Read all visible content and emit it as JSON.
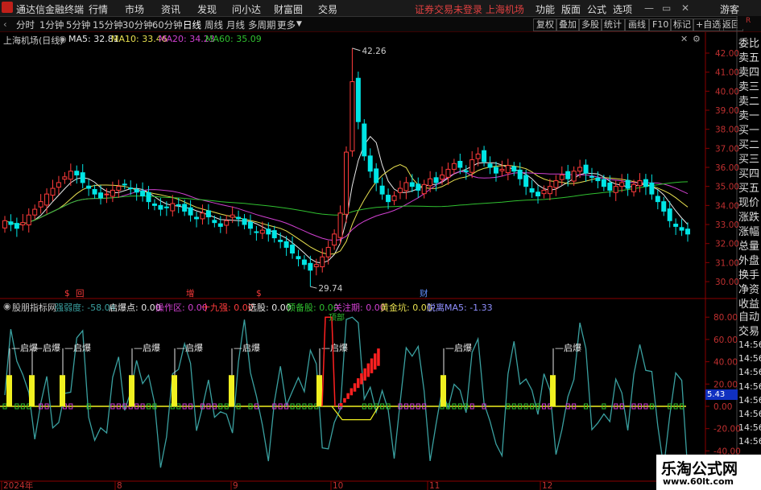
{
  "app": {
    "title": "通达信金融终端",
    "menus": [
      "行情",
      "市场",
      "资讯",
      "发现",
      "问小达",
      "财富圈",
      "交易"
    ],
    "warning": "证券交易未登录 上海机场",
    "right_menus": [
      "功能",
      "版面",
      "公式",
      "选项"
    ],
    "guest": "游客"
  },
  "periods": [
    "分时",
    "1分钟",
    "5分钟",
    "15分钟",
    "30分钟",
    "60分钟",
    "日线",
    "周线",
    "月线",
    "多周期",
    "更多"
  ],
  "selected_period": "日线",
  "toolbar": [
    "复权",
    "叠加",
    "多股",
    "统计",
    "画线",
    "F10",
    "标记",
    "+自选",
    "返回"
  ],
  "main_header": {
    "name": "上海机场(日线)",
    "ma5": "MA5: 32.81",
    "ma10": "MA10: 33.46",
    "ma20": "MA20: 34.23",
    "ma60": "MA60: 35.09"
  },
  "colors": {
    "up": "#ff3b3b",
    "down": "#00e5e5",
    "ma5": "#e8e8e8",
    "ma10": "#e8e050",
    "ma20": "#d040d0",
    "ma60": "#30c030",
    "indicator_line": "#3aa0a0",
    "yellow": "#f0f020"
  },
  "price_axis": [
    "42.00",
    "41.00",
    "40.00",
    "39.00",
    "38.00",
    "37.00",
    "36.00",
    "35.00",
    "34.00",
    "33.00",
    "32.00",
    "31.00",
    "30.00"
  ],
  "high_label": "42.26",
  "low_label": "29.74",
  "event_markers": [
    {
      "x": 80,
      "label": "$"
    },
    {
      "x": 94,
      "label": "回"
    },
    {
      "x": 231,
      "label": "增"
    },
    {
      "x": 318,
      "label": "$"
    },
    {
      "x": 521,
      "label": "财"
    }
  ],
  "sub_header": {
    "name": "股朋指标网",
    "items": [
      "强弱度: -58.04",
      "启爆点: 0.00",
      "操作区: 0.00",
      "十九强: 0.00",
      "选股: 0.00",
      "预备股: 0.00",
      "关注期: 0.00",
      "黄金坑: 0.00",
      "脱离MA5: -1.33"
    ]
  },
  "sub_axis": [
    "80.00",
    "60.00",
    "40.00",
    "20.00",
    "0.00",
    "-20.00",
    "-40.00"
  ],
  "sub_value": "5.43",
  "qibao_label": "启爆",
  "qibao_positions": [
    12,
    40,
    78,
    164,
    217,
    288,
    397,
    551,
    687
  ],
  "top_label": "顶部",
  "date_labels": [
    {
      "x": 2,
      "label": "2024年"
    },
    {
      "x": 143,
      "label": "8"
    },
    {
      "x": 287,
      "label": "9"
    },
    {
      "x": 411,
      "label": "10"
    },
    {
      "x": 531,
      "label": "11"
    },
    {
      "x": 671,
      "label": "12"
    }
  ],
  "side_panel": [
    "委比",
    "卖五",
    "卖四",
    "卖三",
    "卖二",
    "卖一",
    "买一",
    "买二",
    "买三",
    "买四",
    "买五",
    "现价",
    "涨跌",
    "涨幅",
    "总量",
    "外盘",
    "换手",
    "净资",
    "收益"
  ],
  "side_panel2": [
    "自动",
    "交易"
  ],
  "side_times": [
    "14:56",
    "14:56",
    "14:56",
    "14:56",
    "14:56",
    "14:56",
    "14:56",
    "14:56"
  ],
  "watermark": {
    "line1": "乐淘公式网",
    "line2": "www.60lt.com"
  },
  "chart_data": {
    "type": "candlestick",
    "ylim": [
      29.5,
      42.5
    ],
    "closes": [
      33.2,
      33.0,
      32.8,
      33.1,
      33.5,
      33.8,
      34.2,
      34.6,
      34.9,
      35.2,
      35.5,
      35.8,
      35.6,
      35.2,
      34.9,
      34.6,
      34.4,
      34.6,
      34.8,
      35.0,
      35.1,
      34.9,
      34.7,
      34.5,
      34.2,
      34.0,
      33.8,
      33.9,
      34.1,
      34.0,
      33.7,
      33.5,
      33.3,
      33.6,
      33.4,
      33.1,
      32.9,
      33.2,
      33.5,
      33.3,
      33.0,
      32.8,
      32.6,
      32.7,
      32.5,
      32.3,
      32.1,
      31.8,
      31.5,
      31.2,
      30.9,
      30.6,
      30.9,
      31.3,
      31.8,
      32.5,
      33.6,
      36.8,
      40.5,
      38.4,
      36.6,
      35.8,
      35.2,
      34.6,
      34.2,
      34.5,
      34.9,
      35.2,
      35.0,
      34.8,
      35.1,
      35.4,
      35.2,
      35.6,
      35.9,
      36.2,
      36.0,
      35.8,
      36.4,
      36.7,
      36.3,
      36.0,
      35.7,
      35.9,
      36.1,
      35.8,
      35.4,
      35.0,
      34.7,
      34.5,
      34.8,
      35.0,
      35.3,
      35.6,
      35.4,
      35.8,
      36.0,
      35.7,
      35.5,
      35.3,
      35.0,
      34.8,
      35.0,
      35.2,
      34.9,
      35.1,
      35.3,
      35.0,
      34.6,
      34.2,
      33.7,
      33.2,
      32.9,
      32.7,
      32.5
    ],
    "series": [
      {
        "name": "MA5"
      },
      {
        "name": "MA10"
      },
      {
        "name": "MA20"
      },
      {
        "name": "MA60"
      }
    ],
    "annotations": [
      {
        "label": "42.26",
        "y": 42.26
      },
      {
        "label": "29.74",
        "y": 29.74
      }
    ]
  }
}
